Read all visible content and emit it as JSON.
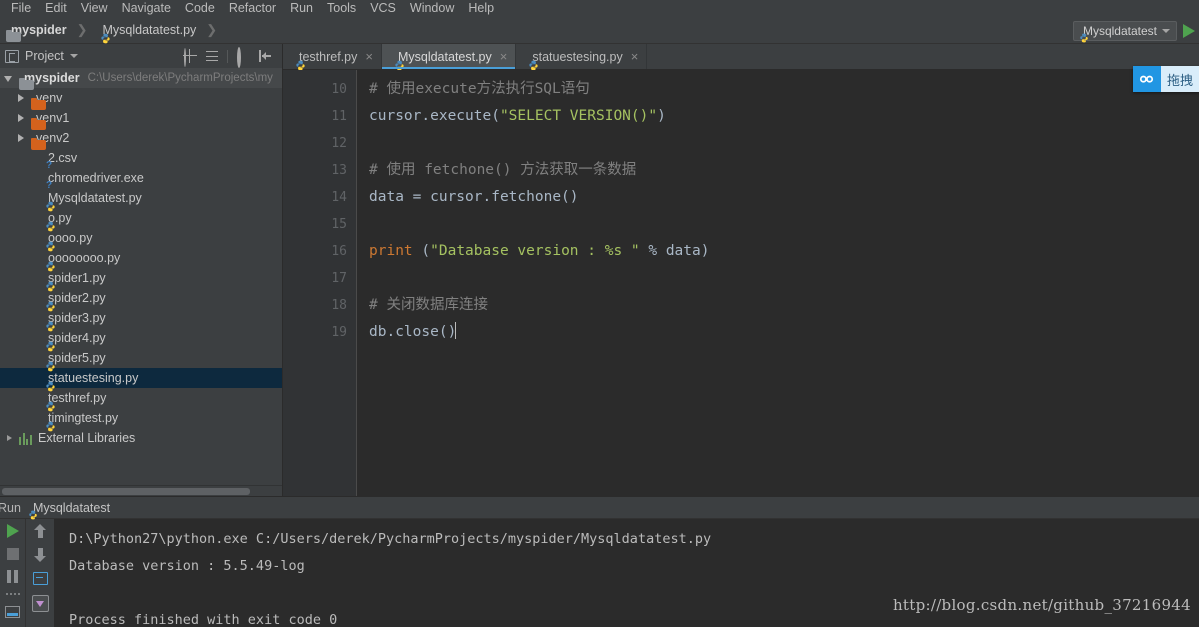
{
  "menubar": {
    "items": [
      "File",
      "Edit",
      "View",
      "Navigate",
      "Code",
      "Refactor",
      "Run",
      "Tools",
      "VCS",
      "Window",
      "Help"
    ]
  },
  "navbar": {
    "breadcrumb": [
      {
        "label": "myspider",
        "icon": "folder-icon"
      },
      {
        "label": "Mysqldatatest.py",
        "icon": "python-file-icon"
      }
    ],
    "run_config": {
      "label": "Mysqldatatest",
      "icon": "python-file-icon"
    },
    "run_button": "run-icon"
  },
  "project_panel": {
    "title": "Project",
    "tools": [
      "locate-target-icon",
      "collapse-all-icon",
      "settings-gear-icon",
      "hide-panel-icon"
    ],
    "tree": [
      {
        "name": "myspider",
        "path": "C:\\Users\\derek\\PycharmProjects\\my",
        "icon": "folder-icon",
        "indent": 0,
        "arrow": "open",
        "bold": true,
        "selected": false,
        "root": true
      },
      {
        "name": "venv",
        "icon": "folder-orange-icon",
        "indent": 1,
        "arrow": "closed",
        "bold": false,
        "selected": false
      },
      {
        "name": "venv1",
        "icon": "folder-orange-icon",
        "indent": 1,
        "arrow": "closed",
        "bold": false,
        "selected": false
      },
      {
        "name": "venv2",
        "icon": "folder-orange-icon",
        "indent": 1,
        "arrow": "closed",
        "bold": false,
        "selected": false
      },
      {
        "name": "2.csv",
        "icon": "unknown-file-icon",
        "indent": 2,
        "arrow": "none",
        "bold": false,
        "selected": false
      },
      {
        "name": "chromedriver.exe",
        "icon": "unknown-file-icon",
        "indent": 2,
        "arrow": "none",
        "bold": false,
        "selected": false
      },
      {
        "name": "Mysqldatatest.py",
        "icon": "python-file-icon",
        "indent": 2,
        "arrow": "none",
        "bold": false,
        "selected": false
      },
      {
        "name": "o.py",
        "icon": "python-file-icon",
        "indent": 2,
        "arrow": "none",
        "bold": false,
        "selected": false
      },
      {
        "name": "oooo.py",
        "icon": "python-file-icon",
        "indent": 2,
        "arrow": "none",
        "bold": false,
        "selected": false
      },
      {
        "name": "oooooooo.py",
        "icon": "python-file-icon",
        "indent": 2,
        "arrow": "none",
        "bold": false,
        "selected": false
      },
      {
        "name": "spider1.py",
        "icon": "python-file-icon",
        "indent": 2,
        "arrow": "none",
        "bold": false,
        "selected": false
      },
      {
        "name": "spider2.py",
        "icon": "python-file-icon",
        "indent": 2,
        "arrow": "none",
        "bold": false,
        "selected": false
      },
      {
        "name": "spider3.py",
        "icon": "python-file-icon",
        "indent": 2,
        "arrow": "none",
        "bold": false,
        "selected": false
      },
      {
        "name": "spider4.py",
        "icon": "python-file-icon",
        "indent": 2,
        "arrow": "none",
        "bold": false,
        "selected": false
      },
      {
        "name": "spider5.py",
        "icon": "python-file-icon",
        "indent": 2,
        "arrow": "none",
        "bold": false,
        "selected": false
      },
      {
        "name": "statuestesing.py",
        "icon": "python-file-icon",
        "indent": 2,
        "arrow": "none",
        "bold": false,
        "selected": true
      },
      {
        "name": "testhref.py",
        "icon": "python-file-icon",
        "indent": 2,
        "arrow": "none",
        "bold": false,
        "selected": false
      },
      {
        "name": "timingtest.py",
        "icon": "python-file-icon",
        "indent": 2,
        "arrow": "none",
        "bold": false,
        "selected": false
      },
      {
        "name": "External Libraries",
        "icon": "libraries-icon",
        "indent": 0,
        "arrow": "sm-closed",
        "bold": false,
        "selected": false
      }
    ]
  },
  "editor": {
    "tabs": [
      {
        "label": "testhref.py",
        "active": false,
        "close": "×"
      },
      {
        "label": "Mysqldatatest.py",
        "active": true,
        "close": "×"
      },
      {
        "label": "statuestesing.py",
        "active": false,
        "close": "×"
      }
    ],
    "line_numbers": [
      "10",
      "11",
      "12",
      "13",
      "14",
      "15",
      "16",
      "17",
      "18",
      "19"
    ],
    "lines": [
      {
        "n": "10",
        "tokens": [
          {
            "t": "# 使用execute方法执行SQL语句",
            "c": "cm"
          }
        ]
      },
      {
        "n": "11",
        "tokens": [
          {
            "t": "cursor.execute(",
            "c": "id"
          },
          {
            "t": "\"SELECT VERSION()\"",
            "c": "st"
          },
          {
            "t": ")",
            "c": "pn"
          }
        ]
      },
      {
        "n": "12",
        "tokens": [
          {
            "t": "",
            "c": "id"
          }
        ]
      },
      {
        "n": "13",
        "tokens": [
          {
            "t": "# 使用 fetchone() 方法获取一条数据",
            "c": "cm"
          }
        ]
      },
      {
        "n": "14",
        "tokens": [
          {
            "t": "data = cursor.fetchone()",
            "c": "id"
          }
        ]
      },
      {
        "n": "15",
        "tokens": [
          {
            "t": "",
            "c": "id"
          }
        ]
      },
      {
        "n": "16",
        "tokens": [
          {
            "t": "print ",
            "c": "kw"
          },
          {
            "t": "(",
            "c": "pn"
          },
          {
            "t": "\"Database version : %s \"",
            "c": "st"
          },
          {
            "t": " % data)",
            "c": "id"
          }
        ]
      },
      {
        "n": "17",
        "tokens": [
          {
            "t": "",
            "c": "id"
          }
        ]
      },
      {
        "n": "18",
        "tokens": [
          {
            "t": "# 关闭数据库连接",
            "c": "cm"
          }
        ]
      },
      {
        "n": "19",
        "tokens": [
          {
            "t": "db.close()",
            "c": "id"
          }
        ]
      }
    ]
  },
  "drag_widget": {
    "label": "拖拽",
    "icon": "link-chain-icon"
  },
  "run_panel": {
    "title": "Run",
    "config_name": "Mysqldatatest",
    "tools_left": [
      "run-icon",
      "stop-icon",
      "pause-icon",
      "dots-icon",
      "console-icon"
    ],
    "tools_right": [
      "scroll-up-icon",
      "scroll-down-icon",
      "soft-wrap-icon",
      "scroll-to-end-icon"
    ],
    "console_lines": [
      "D:\\Python27\\python.exe C:/Users/derek/PycharmProjects/myspider/Mysqldatatest.py",
      "Database version : 5.5.49-log",
      "",
      "Process finished with exit code 0"
    ],
    "watermark": "http://blog.csdn.net/github_37216944"
  }
}
